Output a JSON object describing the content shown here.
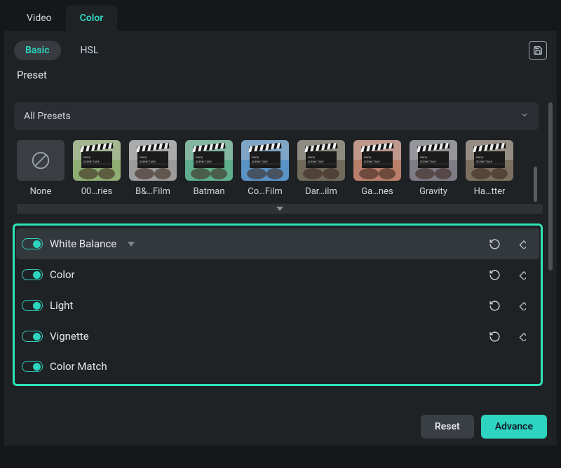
{
  "tabs": {
    "video": "Video",
    "color": "Color"
  },
  "subtabs": {
    "basic": "Basic",
    "hsl": "HSL"
  },
  "section_label": "Preset",
  "dropdown": {
    "label": "All Presets"
  },
  "presets": [
    {
      "label": "None",
      "kind": "none"
    },
    {
      "label": "00…ries",
      "tint": "#8fae74"
    },
    {
      "label": "B&…Film",
      "tint": "#9c9c9c"
    },
    {
      "label": "Batman",
      "tint": "#5fae8e"
    },
    {
      "label": "Co…Film",
      "tint": "#5a94c7"
    },
    {
      "label": "Dar…ilm",
      "tint": "#6f6a5a"
    },
    {
      "label": "Ga…nes",
      "tint": "#b97f6b"
    },
    {
      "label": "Gravity",
      "tint": "#7f7c86"
    },
    {
      "label": "Ha…tter",
      "tint": "#7b6f60"
    }
  ],
  "props": [
    {
      "name": "White Balance",
      "selected": true,
      "expandable": true,
      "has_actions": true
    },
    {
      "name": "Color",
      "selected": false,
      "expandable": false,
      "has_actions": true
    },
    {
      "name": "Light",
      "selected": false,
      "expandable": false,
      "has_actions": true
    },
    {
      "name": "Vignette",
      "selected": false,
      "expandable": false,
      "has_actions": true
    },
    {
      "name": "Color Match",
      "selected": false,
      "expandable": false,
      "has_actions": false
    }
  ],
  "footer": {
    "reset": "Reset",
    "advance": "Advance"
  }
}
